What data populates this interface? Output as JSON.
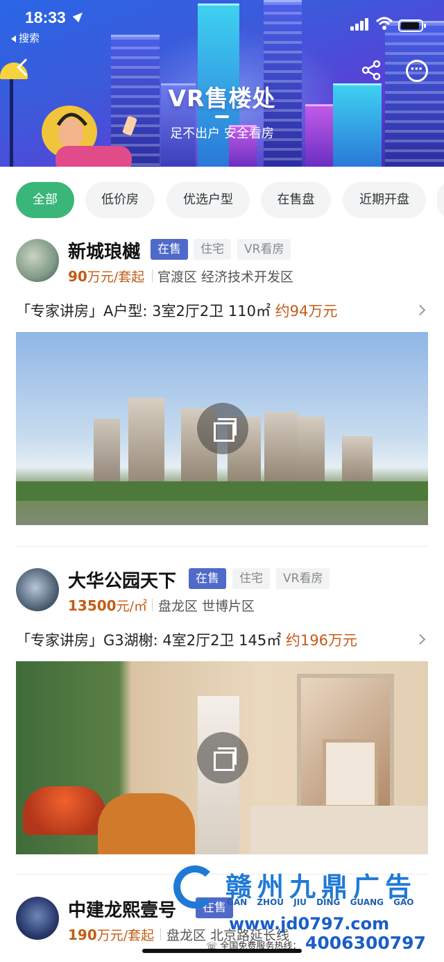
{
  "status_bar": {
    "time": "18:33",
    "back_app": "搜索"
  },
  "banner": {
    "title": "VR售楼处",
    "subtitle": "足不出户 安全看房"
  },
  "filters": [
    "全部",
    "低价房",
    "优选户型",
    "在售盘",
    "近期开盘"
  ],
  "listings": [
    {
      "name": "新城琅樾",
      "tags": [
        "在售",
        "住宅",
        "VR看房"
      ],
      "price_value": "90",
      "price_unit": "万元/套起",
      "area": "官渡区 经济技术开发区",
      "expert_prefix": "「专家讲房」A户型: 3室2厅2卫 110㎡",
      "expert_total": "约94万元"
    },
    {
      "name": "大华公园天下",
      "tags": [
        "在售",
        "住宅",
        "VR看房"
      ],
      "price_value": "13500",
      "price_unit": "元/㎡",
      "area": "盘龙区 世博片区",
      "expert_prefix": "「专家讲房」G3湖榭: 4室2厅2卫 145㎡",
      "expert_total": "约196万元"
    },
    {
      "name": "中建龙熙壹号",
      "tags": [
        "在售"
      ],
      "price_value": "190",
      "price_unit": "万元/套起",
      "area": "盘龙区 北京路延长线"
    }
  ],
  "ad": {
    "title": "赣州九鼎广告",
    "pinyin": "GAN ZHOU JIU DING GUANG GAO",
    "url": "www.jd0797.com",
    "hotline_label": "全国免费服务热线：",
    "phone": "4006300797"
  }
}
